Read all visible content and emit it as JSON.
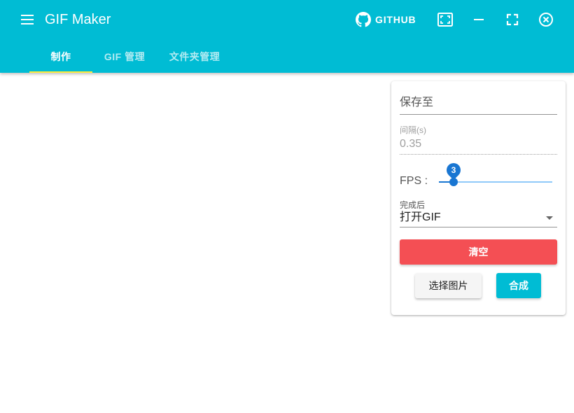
{
  "app": {
    "title": "GIF Maker"
  },
  "toolbar": {
    "github_label": "GITHUB",
    "icons": [
      "menu-icon",
      "github-icon",
      "screenshot-icon",
      "minimize-icon",
      "fullscreen-icon",
      "close-icon"
    ]
  },
  "tabs": [
    {
      "label": "制作",
      "active": true
    },
    {
      "label": "GIF 管理",
      "active": false
    },
    {
      "label": "文件夹管理",
      "active": false
    }
  ],
  "form": {
    "save_to_placeholder": "保存至",
    "interval_label": "间隔(s)",
    "interval_value": "0.35",
    "fps_label": "FPS :",
    "fps_value": "3",
    "fps_fraction": 0.09,
    "after_label": "完成后",
    "after_value": "打开GIF",
    "clear_label": "清空",
    "pick_label": "选择图片",
    "compose_label": "合成"
  },
  "colors": {
    "primary": "#00bcd4",
    "tab_indicator": "#ffeb3b",
    "danger": "#f44f54",
    "slider": "#1976d2"
  }
}
